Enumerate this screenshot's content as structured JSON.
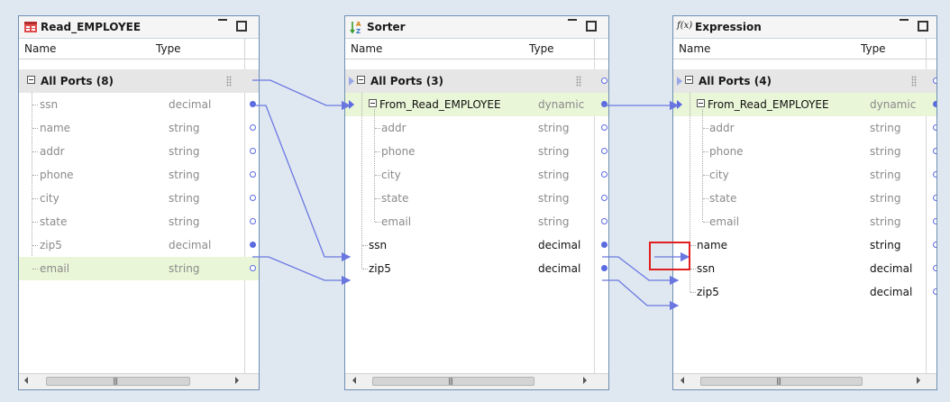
{
  "colors": {
    "canvas_bg": "#dfe8f1",
    "link": "#6b77e0",
    "highlight_row": "#eaf6d8",
    "group_row": "#e6e6e6",
    "callout": "#e02020"
  },
  "columns": {
    "name": "Name",
    "type": "Type"
  },
  "panels": {
    "read": {
      "title": "Read_EMPLOYEE",
      "icon": "read-source-icon",
      "group": "All Ports (8)",
      "ports": [
        {
          "name": "ssn",
          "type": "decimal"
        },
        {
          "name": "name",
          "type": "string"
        },
        {
          "name": "addr",
          "type": "string"
        },
        {
          "name": "phone",
          "type": "string"
        },
        {
          "name": "city",
          "type": "string"
        },
        {
          "name": "state",
          "type": "string"
        },
        {
          "name": "zip5",
          "type": "decimal"
        },
        {
          "name": "email",
          "type": "string"
        }
      ]
    },
    "sorter": {
      "title": "Sorter",
      "icon": "sort-az-icon",
      "group": "All Ports (3)",
      "dyn_group": {
        "name": "From_Read_EMPLOYEE",
        "type": "dynamic"
      },
      "dyn_ports": [
        {
          "name": "addr",
          "type": "string"
        },
        {
          "name": "phone",
          "type": "string"
        },
        {
          "name": "city",
          "type": "string"
        },
        {
          "name": "state",
          "type": "string"
        },
        {
          "name": "email",
          "type": "string"
        }
      ],
      "ports": [
        {
          "name": "ssn",
          "type": "decimal"
        },
        {
          "name": "zip5",
          "type": "decimal"
        }
      ]
    },
    "expression": {
      "title": "Expression",
      "icon": "function-fx-icon",
      "icon_text": "f(x)",
      "group": "All Ports (4)",
      "dyn_group": {
        "name": "From_Read_EMPLOYEE",
        "type": "dynamic"
      },
      "dyn_ports": [
        {
          "name": "addr",
          "type": "string"
        },
        {
          "name": "phone",
          "type": "string"
        },
        {
          "name": "city",
          "type": "string"
        },
        {
          "name": "state",
          "type": "string"
        },
        {
          "name": "email",
          "type": "string"
        }
      ],
      "ports": [
        {
          "name": "name",
          "type": "string"
        },
        {
          "name": "ssn",
          "type": "decimal"
        },
        {
          "name": "zip5",
          "type": "decimal"
        }
      ]
    }
  }
}
